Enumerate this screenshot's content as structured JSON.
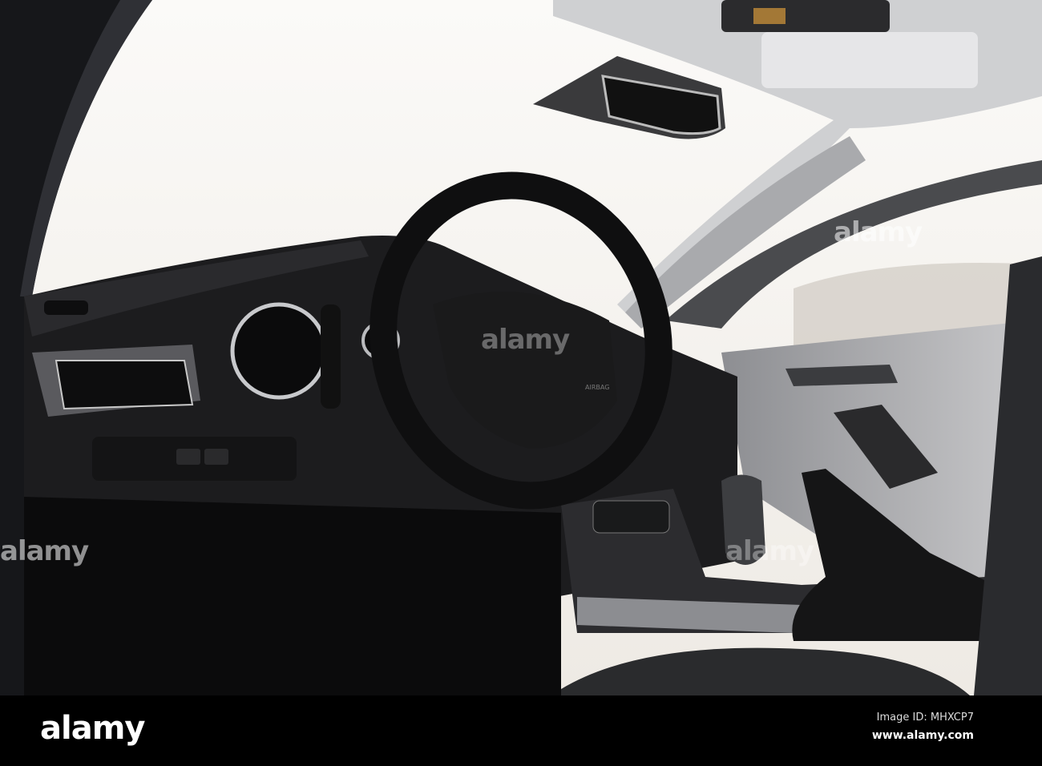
{
  "photo": {
    "subject": "car-interior",
    "airbag_label": "AIRBAG",
    "watermark": "alamy"
  },
  "footer": {
    "logo": "alamy",
    "image_id": "Image ID: MHXCP7",
    "url": "www.alamy.com"
  },
  "colors": {
    "sky": "#f6f4f1",
    "dash": "#1c1c1e",
    "trim": "#8a8b8e",
    "headliner": "#cfd0d2"
  }
}
